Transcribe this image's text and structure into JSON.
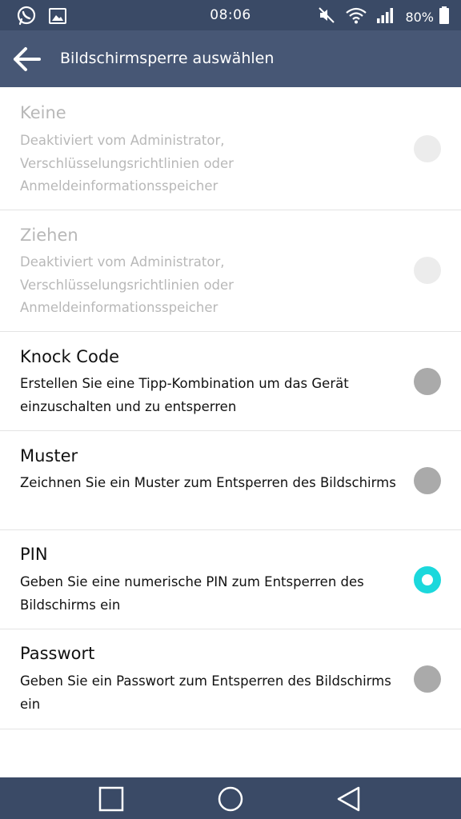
{
  "status_bar": {
    "time": "08:06",
    "battery": "80%",
    "icons_left": [
      "whatsapp-icon",
      "image-icon"
    ],
    "icons_right": [
      "mute-icon",
      "wifi-icon",
      "signal-icon",
      "battery-icon"
    ]
  },
  "app_bar": {
    "title": "Bildschirmsperre auswählen",
    "back_icon": "arrow-left-icon"
  },
  "options": [
    {
      "title": "Keine",
      "description": "Deaktiviert vom Administrator, Verschlüsselungsrichtlinien oder Anmeldeinformationsspeicher",
      "enabled": false,
      "selected": false
    },
    {
      "title": "Ziehen",
      "description": "Deaktiviert vom Administrator, Verschlüsselungsrichtlinien oder Anmeldeinformationsspeicher",
      "enabled": false,
      "selected": false
    },
    {
      "title": "Knock Code",
      "description": "Erstellen Sie eine Tipp-Kombination um das Gerät einzuschalten und zu entsperren",
      "enabled": true,
      "selected": false
    },
    {
      "title": "Muster",
      "description": "Zeichnen Sie ein Muster zum Entsperren des Bildschirms",
      "enabled": true,
      "selected": false
    },
    {
      "title": "PIN",
      "description": "Geben Sie eine numerische PIN zum Entsperren des Bildschirms ein",
      "enabled": true,
      "selected": true
    },
    {
      "title": "Passwort",
      "description": "Geben Sie ein Passwort zum Entsperren des Bildschirms ein",
      "enabled": true,
      "selected": false
    }
  ],
  "nav_bar": {
    "buttons": [
      "recents-square-icon",
      "home-circle-icon",
      "back-triangle-icon"
    ]
  },
  "colors": {
    "status_bar": "#3a4a66",
    "app_bar": "#475775",
    "accent": "#1bd8dc",
    "radio_off": "#aaaaaa",
    "disabled_text": "#b8b8b8"
  }
}
